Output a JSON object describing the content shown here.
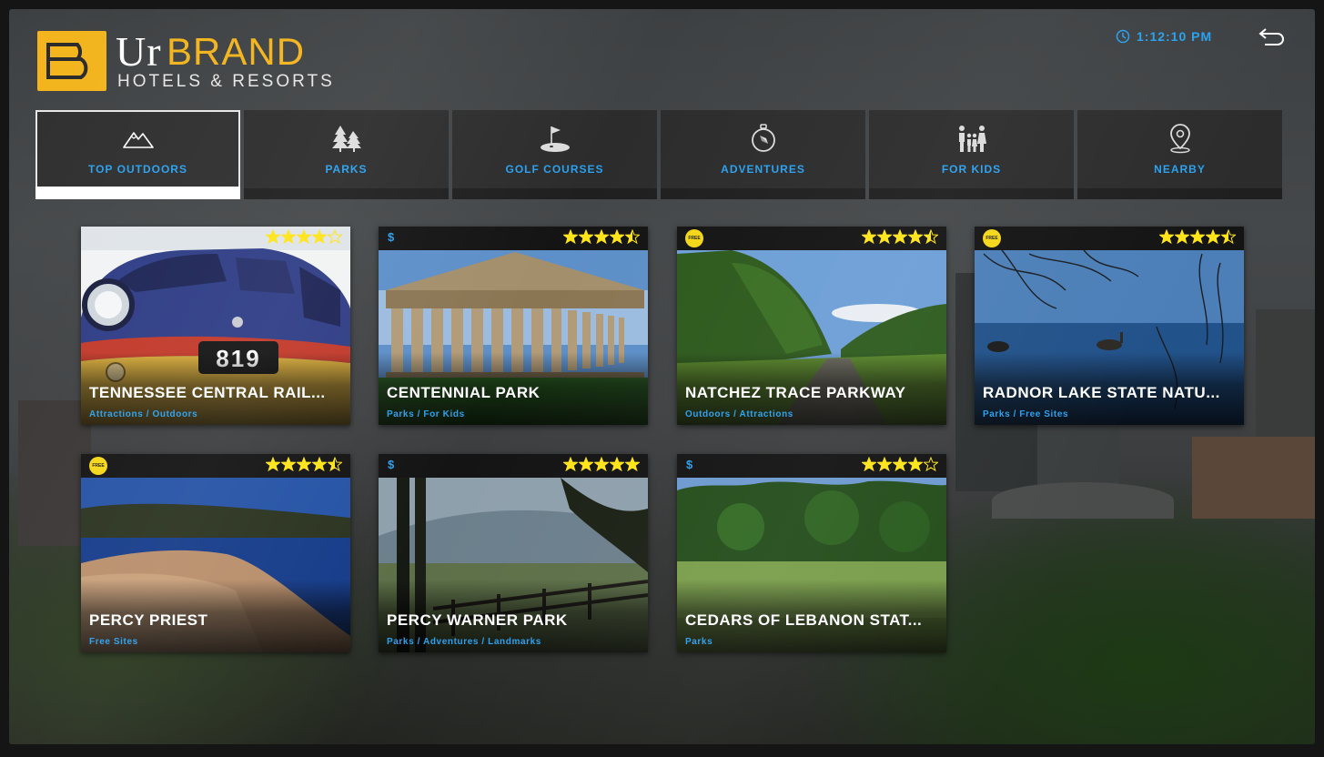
{
  "brand": {
    "name_part1": "Ur",
    "name_part2": "BRAND",
    "subtitle": "HOTELS & RESORTS"
  },
  "header": {
    "time": "1:12:10 PM"
  },
  "tabs": [
    {
      "label": "TOP OUTDOORS",
      "icon": "mountains-icon",
      "active": true
    },
    {
      "label": "PARKS",
      "icon": "trees-icon",
      "active": false
    },
    {
      "label": "GOLF COURSES",
      "icon": "golf-flag-icon",
      "active": false
    },
    {
      "label": "ADVENTURES",
      "icon": "compass-icon",
      "active": false
    },
    {
      "label": "FOR KIDS",
      "icon": "family-icon",
      "active": false
    },
    {
      "label": "NEARBY",
      "icon": "location-pin-icon",
      "active": false
    }
  ],
  "cards": [
    {
      "title": "TENNESSEE CENTRAL RAIL...",
      "tags": "Attractions / Outdoors",
      "rating": 4,
      "badge": "none",
      "plate": "819"
    },
    {
      "title": "CENTENNIAL PARK",
      "tags": "Parks / For Kids",
      "rating": 4.5,
      "badge": "price",
      "price": "$"
    },
    {
      "title": "NATCHEZ TRACE PARKWAY",
      "tags": "Outdoors / Attractions",
      "rating": 4.5,
      "badge": "free",
      "free_label": "FREE"
    },
    {
      "title": "RADNOR LAKE STATE NATU...",
      "tags": "Parks / Free Sites",
      "rating": 4.5,
      "badge": "free",
      "free_label": "FREE"
    },
    {
      "title": "PERCY PRIEST",
      "tags": "Free Sites",
      "rating": 4.5,
      "badge": "free",
      "free_label": "FREE"
    },
    {
      "title": "PERCY WARNER PARK",
      "tags": "Parks / Adventures / Landmarks",
      "rating": 5,
      "badge": "price",
      "price": "$"
    },
    {
      "title": "CEDARS OF LEBANON STAT...",
      "tags": "Parks",
      "rating": 4,
      "badge": "price",
      "price": "$"
    }
  ],
  "colors": {
    "accent": "#2aa0ef",
    "brand_yellow": "#f3b41c",
    "star": "#ffe41a"
  }
}
